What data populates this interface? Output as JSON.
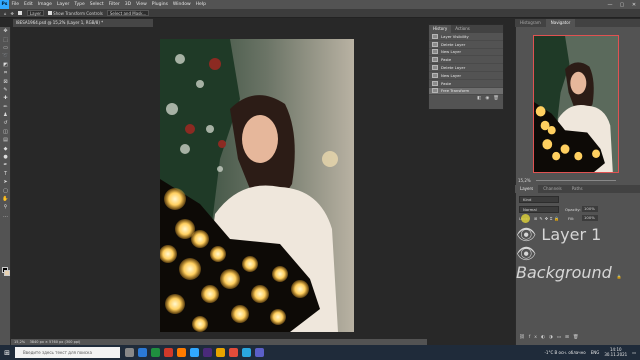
{
  "menubar": {
    "logo": "Ps",
    "items": [
      "File",
      "Edit",
      "Image",
      "Layer",
      "Type",
      "Select",
      "Filter",
      "3D",
      "View",
      "Plugins",
      "Window",
      "Help"
    ],
    "minimize": "—",
    "maximize": "▢",
    "close": "✕"
  },
  "optbar": {
    "autoselect": "Layer",
    "transform_controls": "Show Transform Controls",
    "select_mask": "Select and Mask..."
  },
  "document": {
    "tab_title": "I8ESA1964.psd @ 15,2% (Layer 1, RGB/8) *",
    "zoom_status": "15,2%",
    "dims_status": "3840 px × 5760 px (300 ppi)"
  },
  "history": {
    "tabs": [
      "History",
      "Actions"
    ],
    "steps": [
      "Layer Visibility",
      "Delete Layer",
      "New Layer",
      "Paste",
      "Delete Layer",
      "New Layer",
      "Paste",
      "Free Transform"
    ],
    "selected_index": 7
  },
  "navigator": {
    "tabs": [
      "Histogram",
      "Navigator"
    ],
    "zoom": "15,2%"
  },
  "layers": {
    "tabs": [
      "Layers",
      "Channels",
      "Paths"
    ],
    "search_placeholder": "Kind",
    "mode": "Normal",
    "opacity_label": "Opacity:",
    "opacity_value": "100%",
    "lock_label": "Lock:",
    "fill_label": "Fill:",
    "fill_value": "100%",
    "items": [
      {
        "name": "Layer 1",
        "selected": true
      },
      {
        "name": "Background",
        "selected": false
      }
    ]
  },
  "taskbar": {
    "search_placeholder": "Введите здесь текст для поиска",
    "weather": "-1°C  В осн. облачно",
    "lang": "ENG",
    "time": "14:10",
    "date": "30.11.2021"
  },
  "colors": {
    "accent": "#31a8ff",
    "nav_frame": "#e05252"
  }
}
